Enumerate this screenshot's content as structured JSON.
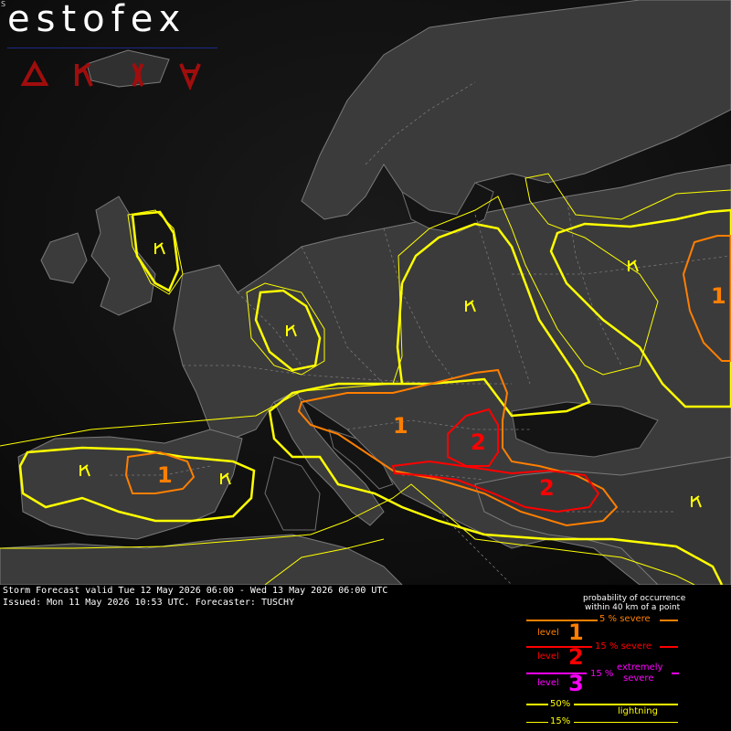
{
  "brand": {
    "name": "estofex",
    "corner_mark": "S"
  },
  "header_icons": [
    {
      "name": "triangle-icon",
      "color": "#a00d0d"
    },
    {
      "name": "wind-gust-icon",
      "color": "#a00d0d"
    },
    {
      "name": "hail-icon",
      "color": "#a00d0d"
    },
    {
      "name": "tornado-icon",
      "color": "#a00d0d"
    }
  ],
  "forecast": {
    "valid_line": "Storm Forecast valid Tue 12 May 2026 06:00 - Wed 13 May 2026 06:00 UTC",
    "issued_line": "Issued: Mon 11 May 2026 10:53 UTC. Forecaster: TUSCHY"
  },
  "map_labels": {
    "iberia_level": "1",
    "balkans_level": "1",
    "romania_level": "2",
    "turkey_level": "2",
    "russia_level": "1"
  },
  "colors": {
    "lightning": "#ffff00",
    "level1": "#ff7f00",
    "level2": "#ff0000",
    "level3": "#ff00ff"
  },
  "legend": {
    "title_line1": "probability of occurrence",
    "title_line2": "within 40 km of a point",
    "level1_label": "level",
    "level1_number": "1",
    "level1_prob": "5 % severe",
    "level2_label": "level",
    "level2_number": "2",
    "level2_prob": "15 % severe",
    "level3_label": "level",
    "level3_number": "3",
    "level3_prob": "15 %",
    "level3_desc1": "extremely",
    "level3_desc2": "severe",
    "lightning_50": "50%",
    "lightning_label": "lightning",
    "lightning_15": "15%"
  }
}
